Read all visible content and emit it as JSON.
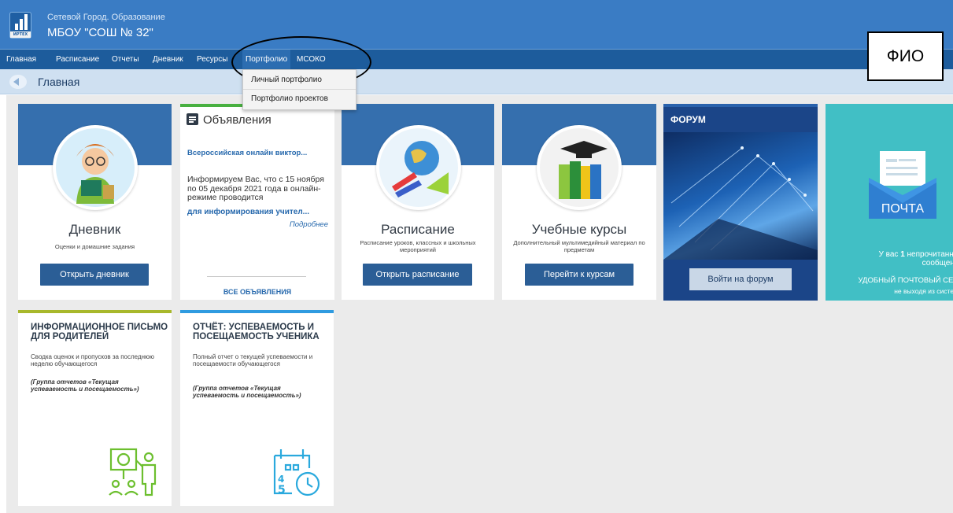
{
  "header": {
    "app_title": "Сетевой Город. Образование",
    "school_name": "МБОУ \"СОШ № 32\"",
    "logo_text": "ИРТЕХ"
  },
  "nav": {
    "items": [
      "Главная",
      "Расписание",
      "Отчеты",
      "Дневник",
      "Ресурсы",
      "Портфолио",
      "МСОКО"
    ],
    "active": "Портфолио"
  },
  "fio_label": "ФИО",
  "breadcrumb": {
    "title": "Главная"
  },
  "dropdown": {
    "items": [
      "Личный портфолио",
      "Портфолио проектов"
    ]
  },
  "cards": {
    "diary": {
      "title": "Дневник",
      "subtitle": "Оценки и домашние задания",
      "button": "Открыть дневник"
    },
    "announcements": {
      "heading": "Объявления",
      "link": "Всероссийская онлайн виктор...",
      "body": "Информируем Вас, что с 15 ноября по 05 декабря 2021 года в онлайн-режиме проводится",
      "bold_line": "для информирования учител...",
      "more": "Подробнее",
      "all": "ВСЕ ОБЪЯВЛЕНИЯ"
    },
    "schedule": {
      "title": "Расписание",
      "subtitle": "Расписание уроков, классных и школьных мероприятий",
      "button": "Открыть расписание"
    },
    "courses": {
      "title": "Учебные курсы",
      "subtitle": "Дополнительный мультимедийный материал по предметам",
      "button": "Перейти к курсам"
    },
    "forum": {
      "title": "ФОРУМ",
      "button": "Войти на форум"
    },
    "mail": {
      "label": "ПОЧТА",
      "unread_prefix": "У вас",
      "unread_count": "1",
      "unread_suffix": "непрочитанных",
      "unread_line2": "сообщений",
      "line3": "УДОБНЫЙ ПОЧТОВЫЙ СЕРВ",
      "line4": "не выходя из системы"
    },
    "parents_letter": {
      "title": "ИНФОРМАЦИОННОЕ ПИСЬМО ДЛЯ РОДИТЕЛЕЙ",
      "desc": "Сводка оценок и пропусков за последнюю неделю обучающегося",
      "group": "(Группа отчетов «Текущая успеваемость и посещаемость»)"
    },
    "report": {
      "title": "ОТЧЁТ: УСПЕВАЕМОСТЬ И ПОСЕЩАЕМОСТЬ УЧЕНИКА",
      "desc": "Полный отчет о текущей успеваемости и посещаемости обучающегося",
      "group": "(Группа отчетов «Текущая успеваемость и посещаемость»)",
      "icon_digit_a": "4",
      "icon_digit_b": "5"
    }
  },
  "colors": {
    "header": "#3a7cc4",
    "nav": "#1d5c9c",
    "card_band": "#356fae",
    "button": "#2b5e96",
    "mail": "#41bfc5",
    "forum": "#1b4588",
    "green_stripe": "#48b040",
    "olive_stripe": "#a8b82c",
    "blue_stripe": "#2f9be0",
    "icon_green": "#6cbf2e",
    "icon_teal": "#2aa9dd"
  }
}
